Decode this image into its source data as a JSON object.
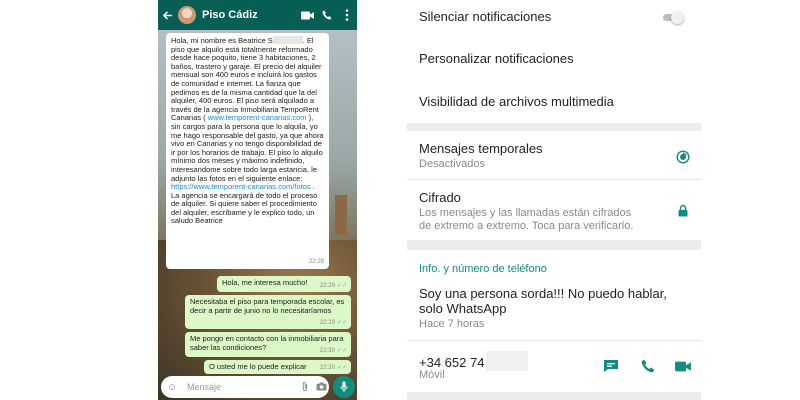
{
  "chat": {
    "contact_name": "Piso Cádiz",
    "incoming": {
      "text_1": "Hola, mi nombre es Beatrice S",
      "text_2": ". El piso que alquilo está totalmente reformado desde hace poquito, tiene 3 habitaciones, 2 baños, trastero y garaje. El precio del alquiler mensual son 400 euros e incluirá los gastos de comunidad e internet. La fianza que pedimos es de la misma cantidad que la del alquiler, 400 euros. El piso será alquilado a través de la agencia Inmobiliaria TempoRent Canarias (",
      "link_1": "www.temporent-canarias.com",
      "text_3": "), sin cargos para la persona que lo alquila, yo me hago responsable del gasto, ya que ahora vivo en Canarias y no tengo disponibilidad de ir por los horarios de trabajo. El piso lo alquilo mínimo dos meses y máximo indefinido, interesandome sobre todo larga estancia, le adjunto las fotos en el siguiente enlace:",
      "link_2": "https://www.temporent-canarias.com/fotos",
      "text_4": ". La agencia se encargará de todo el proceso de alquiler. Si quiere saber el procedimiento del alquiler, escríbame y le explico todo, un saludo Beatrice",
      "time": "22:28"
    },
    "outgoing": [
      {
        "text": "Hola, me interesa mucho!",
        "time": "22:29"
      },
      {
        "text": "Necesitaba el piso para temporada escolar, es decir a partir de junio no lo necesitaríamos",
        "time": "22:29"
      },
      {
        "text": "Me pongo en contacto con la inmobiliaria para saber las condiciones?",
        "time": "22:30"
      },
      {
        "text": "O usted me lo puede explicar",
        "time": "22:30"
      }
    ],
    "input_placeholder": "Mensaje"
  },
  "info": {
    "mute_label": "Silenciar notificaciones",
    "custom_notif_label": "Personalizar notificaciones",
    "media_visibility_label": "Visibilidad de archivos multimedia",
    "temp_messages_label": "Mensajes temporales",
    "temp_messages_status": "Desactivados",
    "encryption_label": "Cifrado",
    "encryption_desc": "Los mensajes y las llamadas están cifrados de extremo a extremo. Toca para verificarlo.",
    "section_title": "Info. y número de teléfono",
    "about_text": "Soy una persona sorda!!! No puedo hablar, solo WhatsApp",
    "about_time": "Hace 7 horas",
    "phone_number": "+34 652 74",
    "phone_type": "Móvil"
  },
  "colors": {
    "header_green": "#075e54",
    "accent_teal": "#128c7e",
    "outgoing_bubble": "#dcf8c6"
  }
}
